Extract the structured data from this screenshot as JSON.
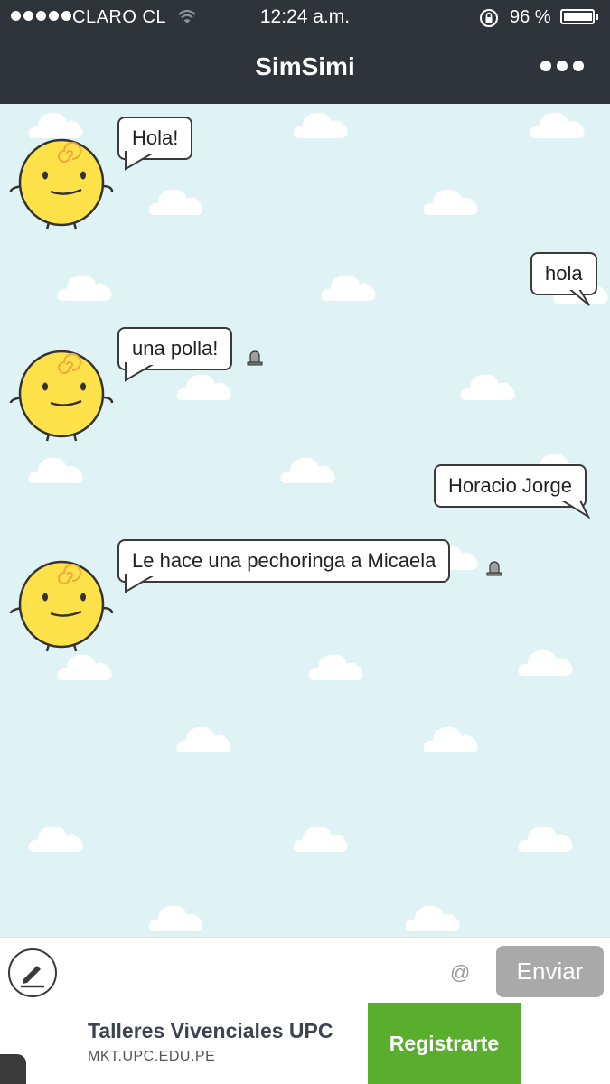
{
  "status_bar": {
    "carrier": "CLARO CL",
    "time": "12:24 a.m.",
    "battery": "96 %",
    "battery_level": 0.96
  },
  "header": {
    "title": "SimSimi"
  },
  "messages": [
    {
      "from": "bot",
      "text": "Hola!"
    },
    {
      "from": "user",
      "text": "hola"
    },
    {
      "from": "bot",
      "text": "una polla!"
    },
    {
      "from": "user",
      "text": "Horacio Jorge"
    },
    {
      "from": "bot",
      "text": "Le hace una pechoringa a Micaela"
    }
  ],
  "input_bar": {
    "message_value": "",
    "at_symbol": "@",
    "send_label": "Enviar"
  },
  "ad": {
    "title": "Talleres Vivenciales UPC",
    "url": "MKT.UPC.EDU.PE",
    "cta_label": "Registrarte"
  },
  "colors": {
    "header_bg": "#2f333a",
    "chat_bg": "#dff3f4",
    "send_button": "#a9a9a9",
    "ad_button": "#5aae2e",
    "avatar_yellow": "#ffe24a"
  }
}
